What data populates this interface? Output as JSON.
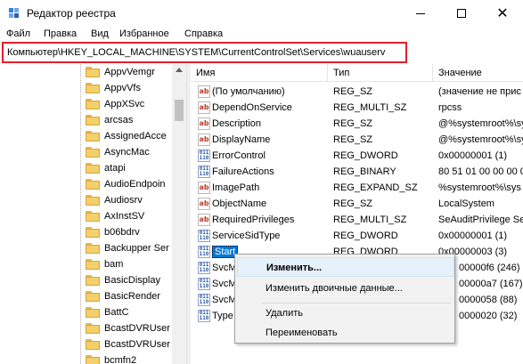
{
  "window": {
    "title": "Редактор реестра"
  },
  "menu": [
    "Файл",
    "Правка",
    "Вид",
    "Избранное",
    "Справка"
  ],
  "address": {
    "path": "Компьютер\\HKEY_LOCAL_MACHINE\\SYSTEM\\CurrentControlSet\\Services\\wuauserv"
  },
  "tree": {
    "items": [
      "AppvVemgr",
      "AppvVfs",
      "AppXSvc",
      "arcsas",
      "AssignedAcce",
      "AsyncMac",
      "atapi",
      "AudioEndpoin",
      "Audiosrv",
      "AxInstSV",
      "b06bdrv",
      "Backupper Ser",
      "bam",
      "BasicDisplay",
      "BasicRender",
      "BattC",
      "BcastDVRUser",
      "BcastDVRUser",
      "bcmfn2"
    ]
  },
  "list": {
    "columns": {
      "name": "Имя",
      "type": "Тип",
      "data": "Значение"
    },
    "rows": [
      {
        "name": "(По умолчанию)",
        "type": "REG_SZ",
        "data": "(значение не прис",
        "icon": "string-value-icon"
      },
      {
        "name": "DependOnService",
        "type": "REG_MULTI_SZ",
        "data": "rpcss",
        "icon": "string-value-icon"
      },
      {
        "name": "Description",
        "type": "REG_SZ",
        "data": "@%systemroot%\\sy",
        "icon": "string-value-icon"
      },
      {
        "name": "DisplayName",
        "type": "REG_SZ",
        "data": "@%systemroot%\\sy",
        "icon": "string-value-icon"
      },
      {
        "name": "ErrorControl",
        "type": "REG_DWORD",
        "data": "0x00000001 (1)",
        "icon": "binary-value-icon"
      },
      {
        "name": "FailureActions",
        "type": "REG_BINARY",
        "data": "80 51 01 00 00 00 00",
        "icon": "binary-value-icon"
      },
      {
        "name": "ImagePath",
        "type": "REG_EXPAND_SZ",
        "data": "%systemroot%\\sys",
        "icon": "string-value-icon"
      },
      {
        "name": "ObjectName",
        "type": "REG_SZ",
        "data": "LocalSystem",
        "icon": "string-value-icon"
      },
      {
        "name": "RequiredPrivileges",
        "type": "REG_MULTI_SZ",
        "data": "SeAuditPrivilege Se",
        "icon": "string-value-icon"
      },
      {
        "name": "ServiceSidType",
        "type": "REG_DWORD",
        "data": "0x00000001 (1)",
        "icon": "binary-value-icon"
      },
      {
        "name": "Start",
        "type": "REG_DWORD",
        "data": "0x00000003 (3)",
        "icon": "binary-value-icon"
      },
      {
        "name": "SvcM",
        "type": "",
        "data": "00000f6 (246)",
        "icon": "binary-value-icon"
      },
      {
        "name": "SvcM",
        "type": "",
        "data": "00000a7 (167)",
        "icon": "binary-value-icon"
      },
      {
        "name": "SvcM",
        "type": "",
        "data": "0000058 (88)",
        "icon": "binary-value-icon"
      },
      {
        "name": "Type",
        "type": "",
        "data": "0000020 (32)",
        "icon": "binary-value-icon"
      }
    ]
  },
  "context_menu": {
    "items": [
      "Изменить...",
      "Изменить двоичные данные...",
      "Удалить",
      "Переименовать"
    ]
  }
}
